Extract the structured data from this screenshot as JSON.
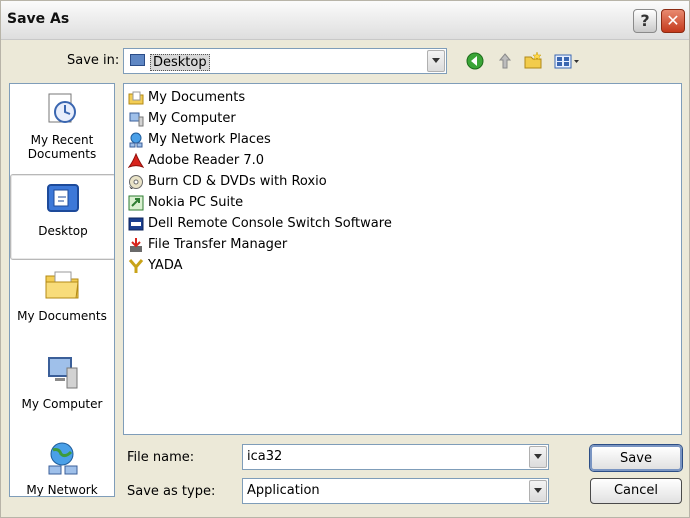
{
  "window": {
    "title": "Save As"
  },
  "titlebar": {
    "help_label": "?",
    "close_label": "✕"
  },
  "savein": {
    "label": "Save in:",
    "value": "Desktop"
  },
  "places": [
    {
      "label": "My Recent Documents",
      "icon": "clock-document-icon"
    },
    {
      "label": "Desktop",
      "icon": "desktop-icon"
    },
    {
      "label": "My Documents",
      "icon": "folder-icon"
    },
    {
      "label": "My Computer",
      "icon": "computer-icon"
    },
    {
      "label": "My Network",
      "icon": "network-icon"
    }
  ],
  "files": [
    {
      "name": "My Documents",
      "icon": "folder-icon"
    },
    {
      "name": "My Computer",
      "icon": "computer-icon"
    },
    {
      "name": "My Network Places",
      "icon": "network-icon"
    },
    {
      "name": "Adobe Reader 7.0",
      "icon": "adobe-icon"
    },
    {
      "name": "Burn CD & DVDs with Roxio",
      "icon": "cd-icon"
    },
    {
      "name": "Nokia PC Suite",
      "icon": "shortcut-icon"
    },
    {
      "name": "Dell Remote Console Switch Software",
      "icon": "dell-icon"
    },
    {
      "name": "File Transfer Manager",
      "icon": "download-icon"
    },
    {
      "name": "YADA",
      "icon": "y-icon"
    }
  ],
  "filename": {
    "label": "File name:",
    "value": "ica32"
  },
  "savetype": {
    "label": "Save as type:",
    "value": "Application"
  },
  "buttons": {
    "save": "Save",
    "cancel": "Cancel"
  },
  "colors": {
    "selection_border": "#7a95c2",
    "close_red": "#c4391c",
    "panel_border": "#7f9db9"
  }
}
